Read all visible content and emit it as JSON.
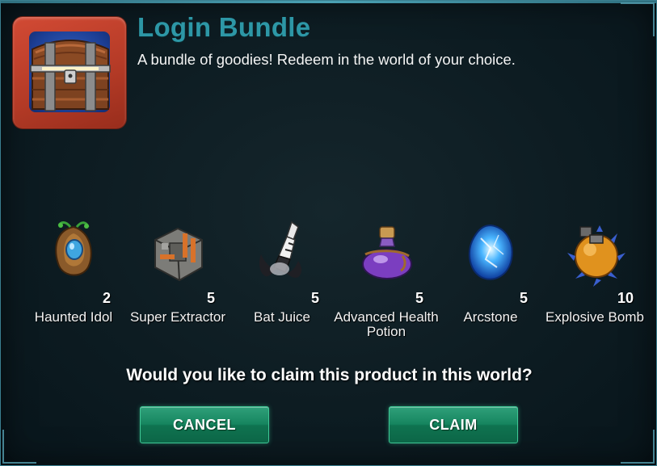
{
  "dialog": {
    "title": "Login Bundle",
    "subtitle": "A bundle of goodies! Redeem in the world of your choice.",
    "icon": "treasure-chest-icon",
    "accent_color": "#2d97a6"
  },
  "items": [
    {
      "name": "Haunted Idol",
      "qty": "2",
      "icon": "haunted-idol-icon"
    },
    {
      "name": "Super Extractor",
      "qty": "5",
      "icon": "super-extractor-icon"
    },
    {
      "name": "Bat Juice",
      "qty": "5",
      "icon": "bat-juice-icon"
    },
    {
      "name": "Advanced Health Potion",
      "qty": "5",
      "icon": "health-potion-icon"
    },
    {
      "name": "Arcstone",
      "qty": "5",
      "icon": "arcstone-icon"
    },
    {
      "name": "Explosive Bomb",
      "qty": "10",
      "icon": "explosive-bomb-icon"
    }
  ],
  "question": "Would you like to claim this product in this world?",
  "buttons": {
    "cancel_label": "CANCEL",
    "claim_label": "CLAIM",
    "color": "#16855f"
  }
}
